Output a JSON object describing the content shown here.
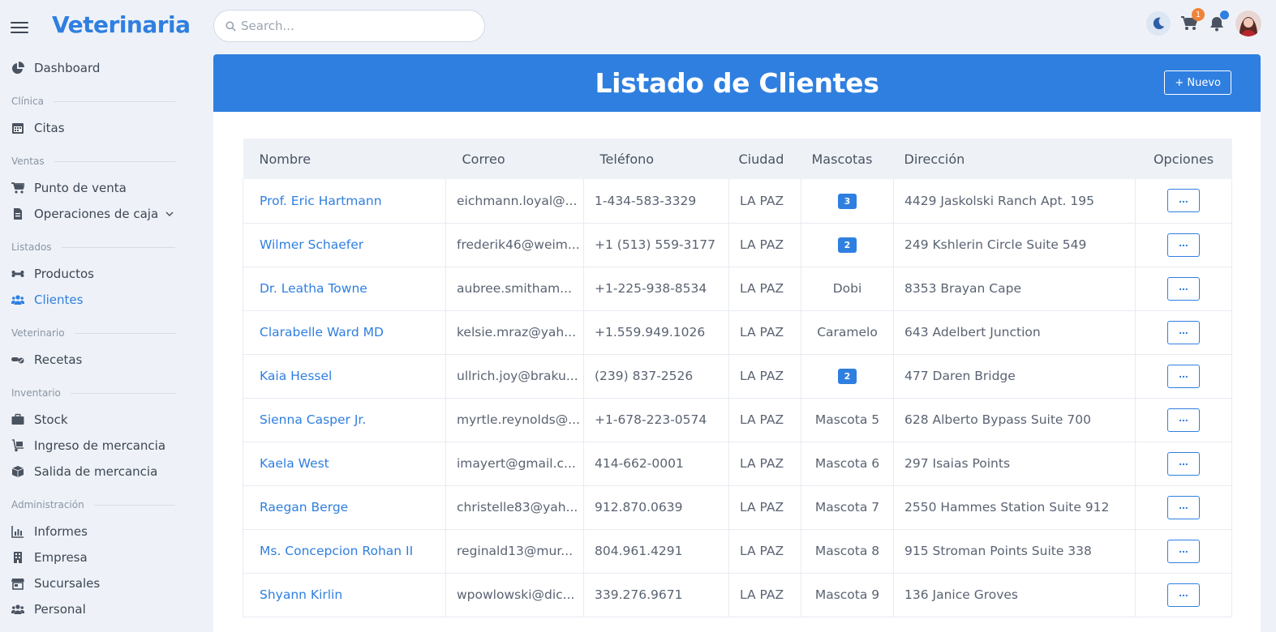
{
  "app": {
    "brand": "Veterinaria"
  },
  "search": {
    "placeholder": "Search..."
  },
  "topbar": {
    "cart_count": "1"
  },
  "sidebar": {
    "items": [
      {
        "type": "item",
        "label": "Dashboard",
        "icon": "chart-pie-icon"
      },
      {
        "type": "section",
        "label": "Clínica"
      },
      {
        "type": "item",
        "label": "Citas",
        "icon": "calendar-icon"
      },
      {
        "type": "section",
        "label": "Ventas"
      },
      {
        "type": "item",
        "label": "Punto de venta",
        "icon": "cart-icon"
      },
      {
        "type": "item",
        "label": "Operaciones de caja",
        "icon": "file-icon",
        "expandable": true
      },
      {
        "type": "section",
        "label": "Listados"
      },
      {
        "type": "item",
        "label": "Productos",
        "icon": "bone-icon"
      },
      {
        "type": "item",
        "label": "Clientes",
        "icon": "users-icon",
        "active": true
      },
      {
        "type": "section",
        "label": "Veterinario"
      },
      {
        "type": "item",
        "label": "Recetas",
        "icon": "pills-icon"
      },
      {
        "type": "section",
        "label": "Inventario"
      },
      {
        "type": "item",
        "label": "Stock",
        "icon": "briefcase-icon"
      },
      {
        "type": "item",
        "label": "Ingreso de mercancia",
        "icon": "dolly-icon"
      },
      {
        "type": "item",
        "label": "Salida de mercancia",
        "icon": "box-icon"
      },
      {
        "type": "section",
        "label": "Administración"
      },
      {
        "type": "item",
        "label": "Informes",
        "icon": "bar-chart-icon"
      },
      {
        "type": "item",
        "label": "Empresa",
        "icon": "building-icon"
      },
      {
        "type": "item",
        "label": "Sucursales",
        "icon": "store-icon"
      },
      {
        "type": "item",
        "label": "Personal",
        "icon": "users-icon"
      }
    ]
  },
  "main": {
    "title": "Listado de Clientes",
    "new_button": "+ Nuevo",
    "columns": [
      "Nombre",
      "Correo",
      "Teléfono",
      "Ciudad",
      "Mascotas",
      "Dirección",
      "Opciones"
    ],
    "rows": [
      {
        "name": "Prof. Eric Hartmann",
        "email": "eichmann.loyal@...",
        "phone": "1-434-583-3329",
        "city": "LA PAZ",
        "pets": "3",
        "pets_badge": true,
        "address": "4429 Jaskolski Ranch Apt. 195"
      },
      {
        "name": "Wilmer Schaefer",
        "email": "frederik46@weim...",
        "phone": "+1 (513) 559-3177",
        "city": "LA PAZ",
        "pets": "2",
        "pets_badge": true,
        "address": "249 Kshlerin Circle Suite 549"
      },
      {
        "name": "Dr. Leatha Towne",
        "email": "aubree.smitham...",
        "phone": "+1-225-938-8534",
        "city": "LA PAZ",
        "pets": "Dobi",
        "pets_badge": false,
        "address": "8353 Brayan Cape"
      },
      {
        "name": "Clarabelle Ward MD",
        "email": "kelsie.mraz@yah...",
        "phone": "+1.559.949.1026",
        "city": "LA PAZ",
        "pets": "Caramelo",
        "pets_badge": false,
        "address": "643 Adelbert Junction"
      },
      {
        "name": "Kaia Hessel",
        "email": "ullrich.joy@braku...",
        "phone": "(239) 837-2526",
        "city": "LA PAZ",
        "pets": "2",
        "pets_badge": true,
        "address": "477 Daren Bridge"
      },
      {
        "name": "Sienna Casper Jr.",
        "email": "myrtle.reynolds@...",
        "phone": "+1-678-223-0574",
        "city": "LA PAZ",
        "pets": "Mascota 5",
        "pets_badge": false,
        "address": "628 Alberto Bypass Suite 700"
      },
      {
        "name": "Kaela West",
        "email": "imayert@gmail.c...",
        "phone": "414-662-0001",
        "city": "LA PAZ",
        "pets": "Mascota 6",
        "pets_badge": false,
        "address": "297 Isaias Points"
      },
      {
        "name": "Raegan Berge",
        "email": "christelle83@yah...",
        "phone": "912.870.0639",
        "city": "LA PAZ",
        "pets": "Mascota 7",
        "pets_badge": false,
        "address": "2550 Hammes Station Suite 912"
      },
      {
        "name": "Ms. Concepcion Rohan II",
        "email": "reginald13@mur...",
        "phone": "804.961.4291",
        "city": "LA PAZ",
        "pets": "Mascota 8",
        "pets_badge": false,
        "address": "915 Stroman Points Suite 338"
      },
      {
        "name": "Shyann Kirlin",
        "email": "wpowlowski@dic...",
        "phone": "339.276.9671",
        "city": "LA PAZ",
        "pets": "Mascota 9",
        "pets_badge": false,
        "address": "136 Janice Groves"
      }
    ]
  },
  "colors": {
    "accent": "#2f7fe0",
    "badge_orange": "#f0833a",
    "background": "#eef2f8"
  }
}
